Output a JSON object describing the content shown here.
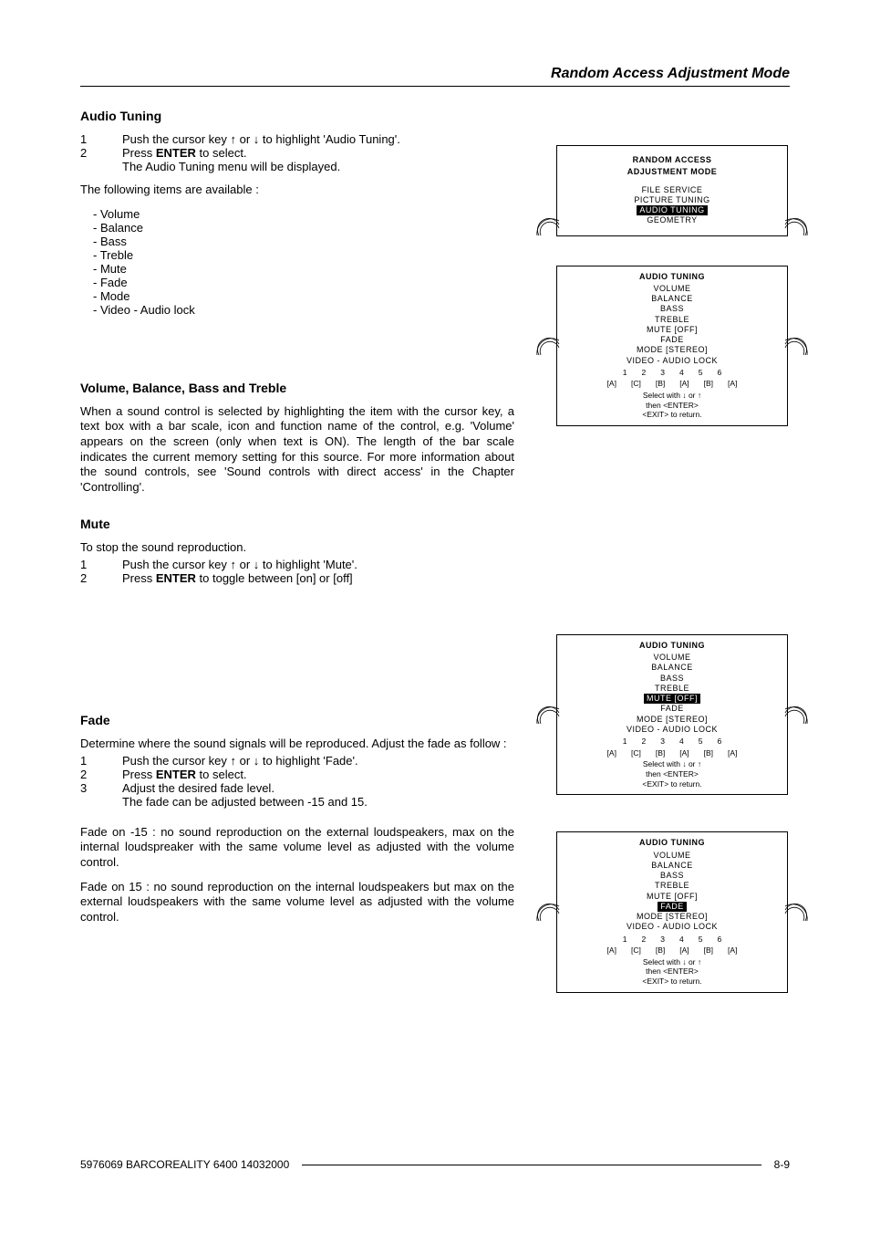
{
  "header": {
    "title": "Random Access Adjustment Mode"
  },
  "sections": {
    "audio_tuning": {
      "heading": "Audio Tuning",
      "step1_pre": "Push the cursor key ",
      "step1_mid": " or ",
      "step1_post": " to highlight 'Audio Tuning'.",
      "step2_pre": "Press ",
      "step2_bold": "ENTER",
      "step2_post": " to select.",
      "step2b": "The Audio Tuning menu will be displayed.",
      "items_intro": "The following items are available :",
      "items": [
        "- Volume",
        "- Balance",
        "- Bass",
        "- Treble",
        "- Mute",
        "- Fade",
        "- Mode",
        "- Video - Audio lock"
      ]
    },
    "vbbt": {
      "heading": "Volume, Balance, Bass and Treble",
      "para": "When a sound control is selected by highlighting the item with the cursor key, a text box with a bar scale, icon and function name of the control, e.g. 'Volume' appears on the screen (only when text is ON).  The length of the bar scale indicates the current memory setting for this source.  For more information about the sound controls, see 'Sound controls with direct access' in the Chapter 'Controlling'."
    },
    "mute": {
      "heading": "Mute",
      "intro": "To stop the sound reproduction.",
      "step1_pre": "Push the cursor key ",
      "step1_mid": " or ",
      "step1_post": " to highlight 'Mute'.",
      "step2_pre": "Press ",
      "step2_bold": "ENTER",
      "step2_post": " to toggle between [on] or [off]"
    },
    "fade": {
      "heading": "Fade",
      "intro": "Determine where the sound signals will be reproduced. Adjust the fade as follow :",
      "step1_pre": "Push the cursor key ",
      "step1_mid": " or ",
      "step1_post": " to highlight 'Fade'.",
      "step2_pre": "Press ",
      "step2_bold": "ENTER",
      "step2_post": " to select.",
      "step3a": "Adjust the desired fade level.",
      "step3b": "The fade can be adjusted between -15 and 15.",
      "para_neg": "Fade on -15 : no sound reproduction on the external loudspeakers, max on the internal loudspreaker with the same volume level as adjusted with the volume control.",
      "para_pos": "Fade on 15 : no sound reproduction on the internal loudspeakers but max on the external loudspeakers with the same volume level as adjusted with the volume control."
    }
  },
  "osd": {
    "top": {
      "title1": "RANDOM  ACCESS",
      "title2": "ADJUSTMENT MODE",
      "lines": [
        "FILE SERVICE",
        "PICTURE TUNING"
      ],
      "highlight": "AUDIO TUNING",
      "after": [
        "GEOMETRY"
      ]
    },
    "bottom1": {
      "title": "AUDIO TUNING",
      "lines": [
        "VOLUME",
        "BALANCE",
        "BASS",
        "TREBLE",
        "MUTE [OFF]",
        "FADE",
        "MODE [STEREO]",
        "VIDEO - AUDIO LOCK"
      ],
      "nums": [
        "1",
        "2",
        "3",
        "4",
        "5",
        "6"
      ],
      "labs": [
        "[A]",
        "[C]",
        "[B]",
        "[A]",
        "[B]",
        "[A]"
      ],
      "f1_pre": "Select with ",
      "f1_mid": " or ",
      "f2": "then  <ENTER>",
      "f3": "<EXIT>  to return."
    },
    "bottom2": {
      "title": "AUDIO TUNING",
      "before": [
        "VOLUME",
        "BALANCE",
        "BASS",
        "TREBLE"
      ],
      "highlight": "MUTE [OFF]",
      "after": [
        "FADE",
        "MODE [STEREO]",
        "VIDEO - AUDIO LOCK"
      ],
      "nums": [
        "1",
        "2",
        "3",
        "4",
        "5",
        "6"
      ],
      "labs": [
        "[A]",
        "[C]",
        "[B]",
        "[A]",
        "[B]",
        "[A]"
      ],
      "f1_pre": "Select with ",
      "f1_mid": " or ",
      "f2": "then  <ENTER>",
      "f3": "<EXIT>  to return."
    },
    "bottom3": {
      "title": "AUDIO TUNING",
      "before": [
        "VOLUME",
        "BALANCE",
        "BASS",
        "TREBLE",
        "MUTE [OFF]"
      ],
      "highlight": "FADE",
      "after": [
        "MODE [STEREO]",
        "VIDEO - AUDIO LOCK"
      ],
      "nums": [
        "1",
        "2",
        "3",
        "4",
        "5",
        "6"
      ],
      "labs": [
        "[A]",
        "[C]",
        "[B]",
        "[A]",
        "[B]",
        "[A]"
      ],
      "f1_pre": "Select with ",
      "f1_mid": " or ",
      "f2": "then  <ENTER>",
      "f3": "<EXIT>  to return."
    }
  },
  "glyphs": {
    "up": "↑",
    "down": "↓"
  },
  "nums": {
    "n1": "1",
    "n2": "2",
    "n3": "3"
  },
  "footer": {
    "left": "5976069 BARCOREALITY 6400 14032000",
    "right": "8-9"
  }
}
